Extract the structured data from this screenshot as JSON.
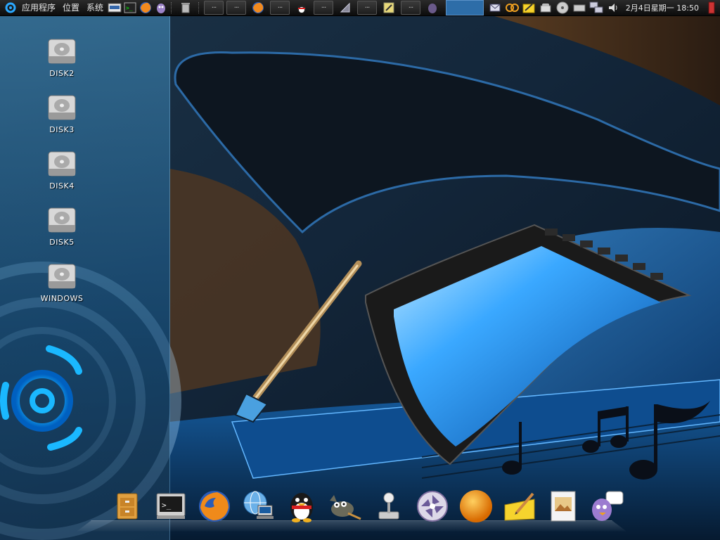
{
  "top_panel": {
    "menus": [
      "应用程序",
      "位置",
      "系统"
    ],
    "launchers": [
      "mplayer-icon",
      "terminal-icon",
      "firefox-icon",
      "pidgin-icon"
    ],
    "taskbar": [
      "trash-icon",
      "window-task",
      "window-task",
      "firefox-task",
      "window-task",
      "qq-task",
      "window-task",
      "gparted-task",
      "window-task",
      "gedit-task",
      "window-task",
      "pidgin-task"
    ],
    "task_ellipsis": "···",
    "tray": [
      "mail-icon",
      "network-refresh-icon",
      "notes-icon",
      "phone-icon",
      "keyboard-icon",
      "network-icon",
      "volume-icon"
    ],
    "clock": "2月4日星期一 18:50"
  },
  "desktop": {
    "icons": [
      {
        "label": "DISK2"
      },
      {
        "label": "DISK3"
      },
      {
        "label": "DISK4"
      },
      {
        "label": "DISK5"
      },
      {
        "label": "WINDOWS"
      }
    ]
  },
  "dock": {
    "items": [
      "file-cabinet-icon",
      "terminal-icon",
      "firefox-icon",
      "network-globe-icon",
      "qq-penguin-icon",
      "gimp-icon",
      "joystick-icon",
      "aperture-icon",
      "orange-ball-icon",
      "notes-pencil-icon",
      "image-viewer-icon",
      "pidgin-chat-icon"
    ]
  },
  "colors": {
    "panel": "#1a1a1a",
    "workspace": "#2d6da8",
    "accent": "#1e88d8"
  }
}
